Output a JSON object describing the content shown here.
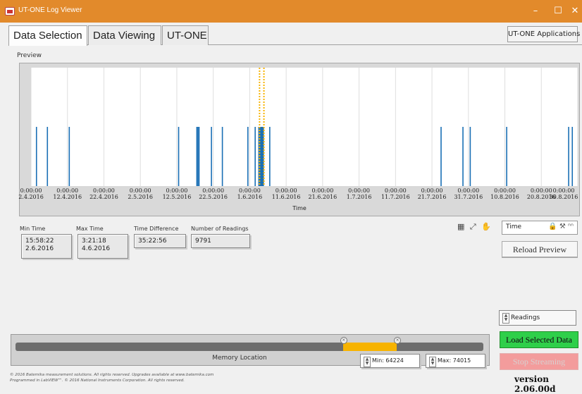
{
  "window": {
    "title": "UT-ONE Log Viewer",
    "minimize": "–",
    "maximize": "☐",
    "close": "✕",
    "accent": "#e28a2b"
  },
  "tabs": [
    {
      "label": "Data Selection",
      "active": true
    },
    {
      "label": "Data Viewing",
      "active": false
    },
    {
      "label": "UT-ONE",
      "active": false
    }
  ],
  "apps_button": "UT-ONE Applications",
  "preview": {
    "label": "Preview",
    "axis_title": "Time",
    "ticks": [
      {
        "time": "0:00:00",
        "date": "2.4.2016"
      },
      {
        "time": "0:00:00",
        "date": "12.4.2016"
      },
      {
        "time": "0:00:00",
        "date": "22.4.2016"
      },
      {
        "time": "0:00:00",
        "date": "2.5.2016"
      },
      {
        "time": "0:00:00",
        "date": "12.5.2016"
      },
      {
        "time": "0:00:00",
        "date": "22.5.2016"
      },
      {
        "time": "0:00:00",
        "date": "1.6.2016"
      },
      {
        "time": "0:00:00",
        "date": "11.6.2016"
      },
      {
        "time": "0:00:00",
        "date": "21.6.2016"
      },
      {
        "time": "0:00:00",
        "date": "1.7.2016"
      },
      {
        "time": "0:00:00",
        "date": "11.7.2016"
      },
      {
        "time": "0:00:00",
        "date": "21.7.2016"
      },
      {
        "time": "0:00:00",
        "date": "31.7.2016"
      },
      {
        "time": "0:00:00",
        "date": "10.8.2016"
      },
      {
        "time": "0:00:00",
        "date": "20.8.2016"
      },
      {
        "time": "0:00:00",
        "date": "30.8.2016"
      }
    ]
  },
  "chart_data": {
    "type": "bar",
    "xlabel": "Time",
    "x_range": [
      "2.4.2016",
      "30.8.2016"
    ],
    "grid": true,
    "bar_color": "#1a6fb5",
    "selection_color": "#f7b300",
    "readings_at_days": [
      1.5,
      4.5,
      10.5,
      40.5,
      45.5,
      45.8,
      46.1,
      49.5,
      52.5,
      59.5,
      61.5,
      62.5,
      62.8,
      63.1,
      63.4,
      65.5,
      112.5,
      118.5,
      120.5,
      130.5,
      147.5,
      148.5
    ],
    "selection_days": [
      62.7,
      63.9
    ]
  },
  "stats": {
    "min_time_label": "Min Time",
    "min_time": "15:58:22",
    "min_date": "2.6.2016",
    "max_time_label": "Max Time",
    "max_time": "3:21:18",
    "max_date": "4.6.2016",
    "diff_label": "Time Difference",
    "diff": "35:22:56",
    "count_label": "Number of Readings",
    "count": "9791"
  },
  "graph_tools": "▦ ⤢ ✋",
  "time_select": {
    "value": "Time",
    "icons": "🔒 ⚒ ⁿⁿ"
  },
  "reload_button": "Reload Preview",
  "readings_select": "Readings",
  "load_button": "Load Selected Data",
  "stop_button": "Stop Streaming",
  "memory": {
    "label": "Memory Location",
    "min_label": "Min: 64224",
    "max_label": "Max: 74015",
    "min_value": 64224,
    "max_value": 74015,
    "sel_start": 0.7,
    "sel_end": 0.815
  },
  "footer": {
    "line1": "© 2016 Batemika measurement solutions. All rights reserved. Upgrades available at www.batemika.com",
    "line2": "Programmed in LabVIEW™. © 2016 National Instruments Corporation. All rights reserved."
  },
  "version": "version 2.06.00d"
}
